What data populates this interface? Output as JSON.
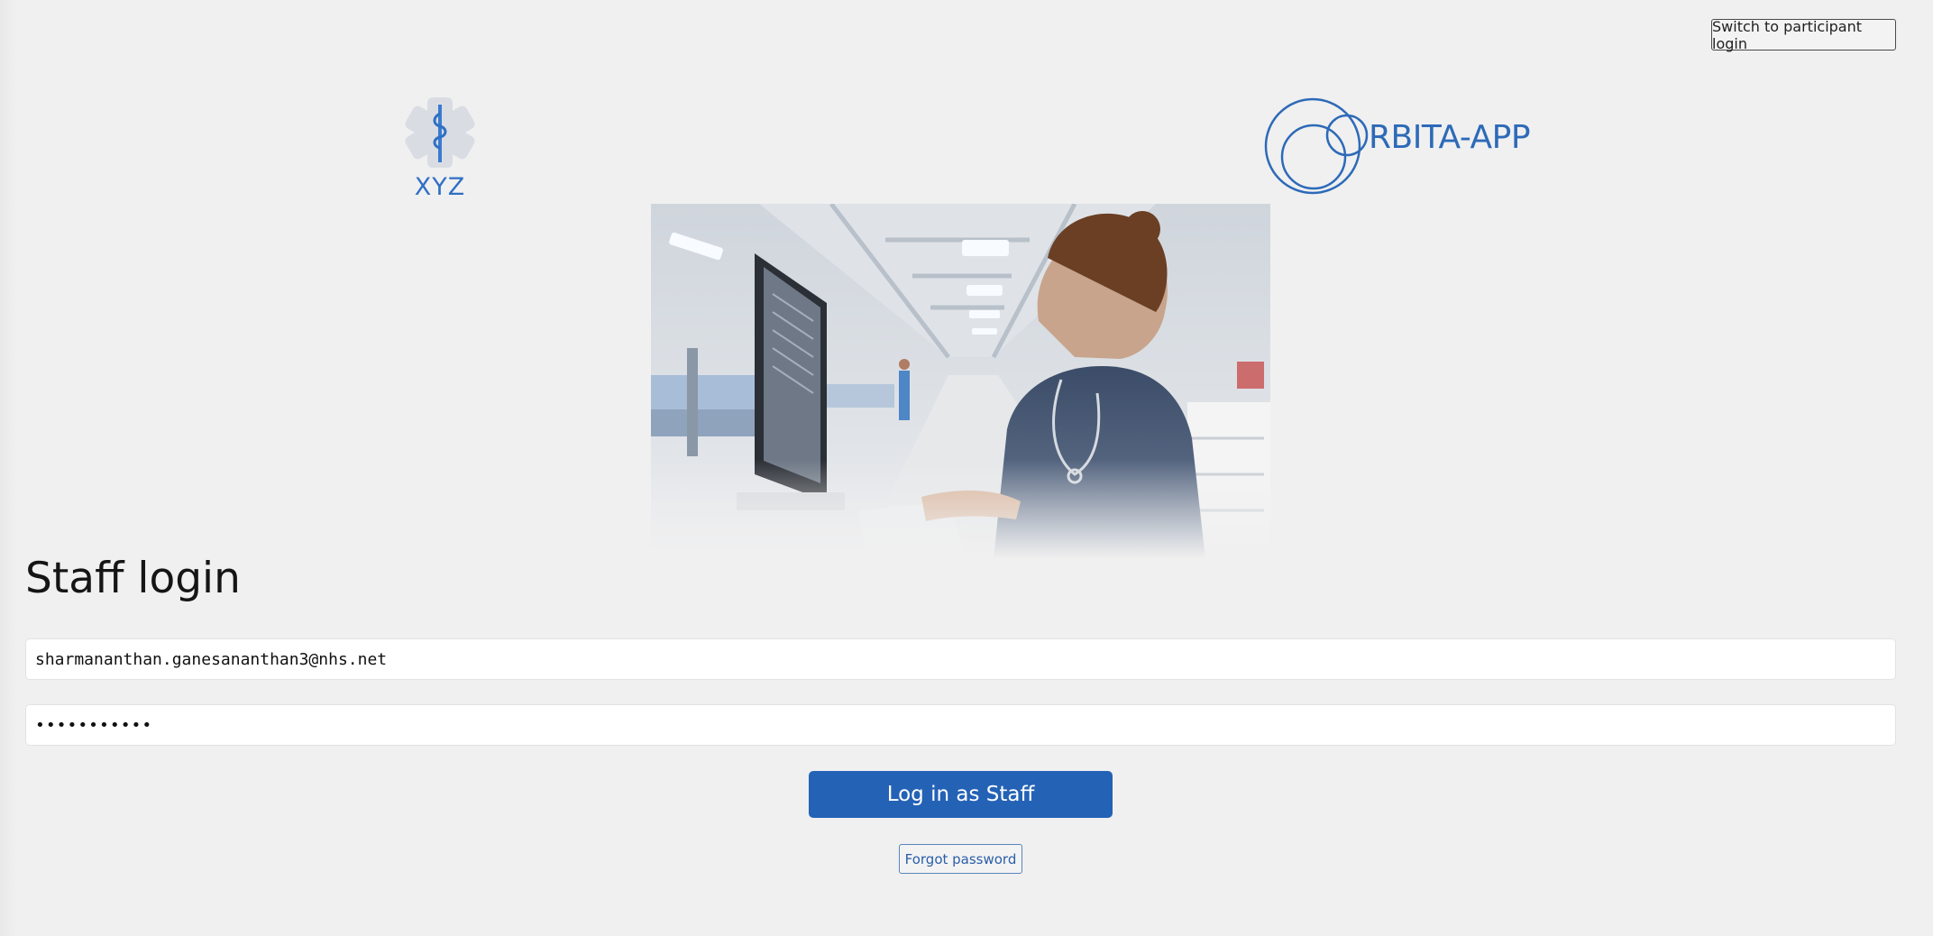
{
  "header": {
    "switch_label": "Switch to participant login"
  },
  "logos": {
    "left_text": "XYZ",
    "right_text": "RBITA-APP"
  },
  "main": {
    "title": "Staff login",
    "email_value": "sharmananthan.ganesananthan3@nhs.net",
    "password_value": "•••••••••••",
    "login_label": "Log in as Staff",
    "forgot_label": "Forgot password"
  },
  "colors": {
    "accent": "#2462b6",
    "logo_blue": "#2d6ab8",
    "background": "#f0f0f0"
  }
}
